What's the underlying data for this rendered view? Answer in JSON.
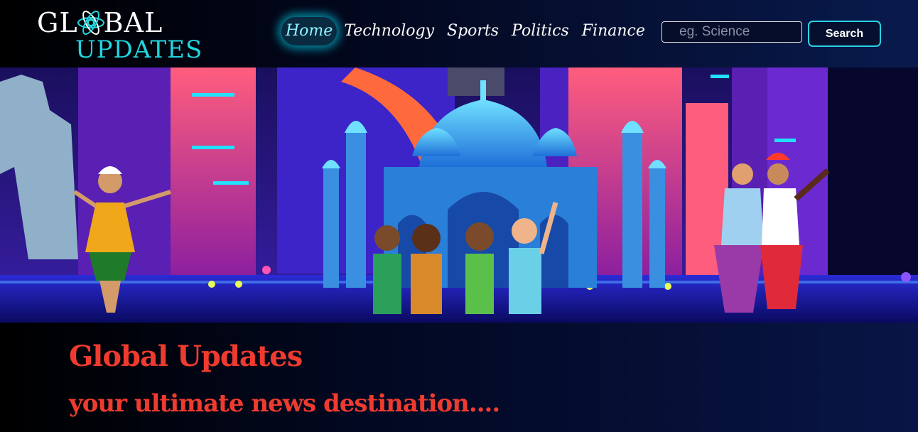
{
  "logo": {
    "top_before": "GL",
    "top_after": "BAL",
    "bottom": "UPDATES"
  },
  "nav": {
    "items": [
      "Home",
      "Technology",
      "Sports",
      "Politics",
      "Finance"
    ],
    "active": "Home"
  },
  "search": {
    "placeholder": "eg. Science",
    "value": "",
    "button_label": "Search"
  },
  "hero": {
    "image": "banner-illustration",
    "description_icons": [
      "taj-mahal-icon",
      "dancer-icon",
      "crowd-icon",
      "statue-icon"
    ]
  },
  "intro": {
    "title": "Global Updates",
    "subtitle": "your ultimate news destination...."
  },
  "colors": {
    "accent_cyan": "#28d3e6",
    "title_red": "#ef3b2f",
    "nav_bg": "#000000"
  }
}
